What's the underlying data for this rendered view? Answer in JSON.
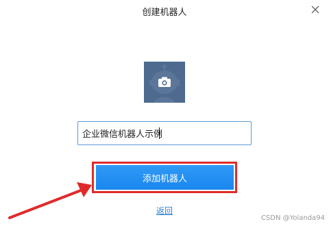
{
  "dialog": {
    "title": "创建机器人",
    "close_icon": "close-icon"
  },
  "avatar": {
    "icon": "camera-icon",
    "background_color": "#4e6a8f"
  },
  "name_input": {
    "value": "企业微信机器人示例"
  },
  "add_button": {
    "label": "添加机器人",
    "color": "#1a86ef"
  },
  "back_link": {
    "label": "返回"
  },
  "annotation": {
    "highlight_color": "#e02a2a",
    "arrow_color": "#e02a2a"
  },
  "watermark": {
    "text": "CSDN @Yolanda94"
  }
}
